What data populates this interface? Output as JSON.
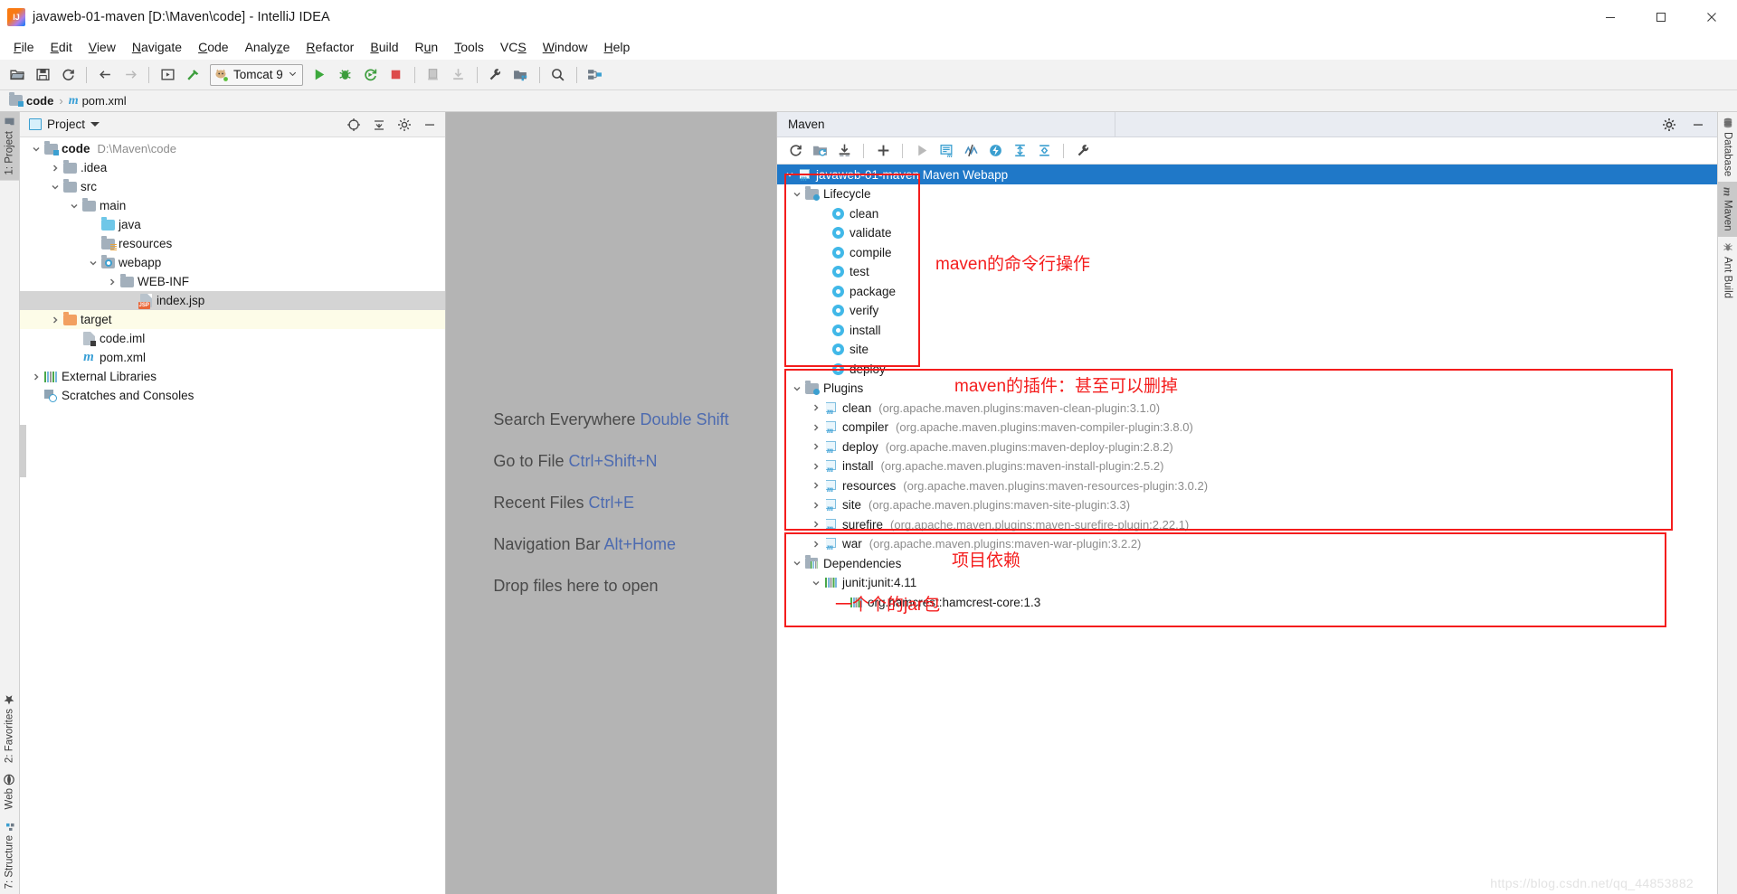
{
  "window": {
    "title": "javaweb-01-maven [D:\\Maven\\code] - IntelliJ IDEA",
    "app_icon": "intellij-idea-icon",
    "minimize": "minimize-icon",
    "maximize": "maximize-icon",
    "close": "close-icon"
  },
  "menubar": {
    "items": [
      {
        "label": "File",
        "mnemonic": "F"
      },
      {
        "label": "Edit",
        "mnemonic": "E"
      },
      {
        "label": "View",
        "mnemonic": "V"
      },
      {
        "label": "Navigate",
        "mnemonic": "N"
      },
      {
        "label": "Code",
        "mnemonic": "C"
      },
      {
        "label": "Analyze",
        "mnemonic": "z"
      },
      {
        "label": "Refactor",
        "mnemonic": "R"
      },
      {
        "label": "Build",
        "mnemonic": "B"
      },
      {
        "label": "Run",
        "mnemonic": "u"
      },
      {
        "label": "Tools",
        "mnemonic": "T"
      },
      {
        "label": "VCS",
        "mnemonic": "S"
      },
      {
        "label": "Window",
        "mnemonic": "W"
      },
      {
        "label": "Help",
        "mnemonic": "H"
      }
    ]
  },
  "toolbar": {
    "open_icon": "open-folder-icon",
    "save_icon": "save-all-icon",
    "sync_icon": "synchronize-icon",
    "back_icon": "back-arrow-icon",
    "forward_icon": "forward-arrow-icon",
    "compile_icon": "compile-icon",
    "build_icon": "build-hammer-icon",
    "run_config": {
      "label": "Tomcat 9",
      "icon": "tomcat-cat-icon",
      "dropdown": "chevron-down-icon"
    },
    "run_icon": "run-green-play-icon",
    "debug_icon": "debug-bug-icon",
    "run_coverage_icon": "run-with-coverage-icon",
    "stop_icon": "stop-red-square-icon",
    "update_app_icon": "update-application-icon",
    "deploy_icon": "deploy-icon",
    "settings_icon": "wrench-settings-icon",
    "project_structure_icon": "project-structure-icon",
    "search_icon": "search-icon",
    "vcs_icon": "vcs-operations-icon"
  },
  "breadcrumb": {
    "root": "code",
    "separator": "›",
    "file_icon": "maven-m-icon",
    "file": "pom.xml"
  },
  "left_strip": {
    "top": [
      {
        "label": "1: Project",
        "icon": "project-folder-icon",
        "active": true
      }
    ],
    "bottom": [
      {
        "label": "2: Favorites",
        "icon": "star-icon",
        "active": false
      },
      {
        "label": "Web",
        "icon": "web-globe-icon",
        "active": false
      },
      {
        "label": "7: Structure",
        "icon": "structure-icon",
        "active": false
      }
    ]
  },
  "right_strip": [
    {
      "label": "Database",
      "icon": "database-icon",
      "active": false
    },
    {
      "label": "Maven",
      "icon": "maven-m-icon",
      "active": true
    },
    {
      "label": "Ant Build",
      "icon": "ant-icon",
      "active": false
    }
  ],
  "project_panel": {
    "title": "Project",
    "dropdown_icon": "chevron-down-icon",
    "locate_icon": "scroll-from-source-icon",
    "collapse_icon": "collapse-all-icon",
    "settings_icon": "gear-icon",
    "hide_icon": "hide-icon",
    "tree": [
      {
        "label": "code",
        "sub": "D:\\Maven\\code",
        "indent": 0,
        "arrow": "down",
        "icon": "module-folder-icon",
        "bold": true,
        "state": "normal"
      },
      {
        "label": ".idea",
        "sub": "",
        "indent": 1,
        "arrow": "right",
        "icon": "folder-icon",
        "bold": false,
        "state": "normal"
      },
      {
        "label": "src",
        "sub": "",
        "indent": 1,
        "arrow": "down",
        "icon": "folder-icon",
        "bold": false,
        "state": "normal"
      },
      {
        "label": "main",
        "sub": "",
        "indent": 2,
        "arrow": "down",
        "icon": "folder-icon",
        "bold": false,
        "state": "normal"
      },
      {
        "label": "java",
        "sub": "",
        "indent": 3,
        "arrow": "none",
        "icon": "source-folder-icon",
        "bold": false,
        "state": "normal"
      },
      {
        "label": "resources",
        "sub": "",
        "indent": 3,
        "arrow": "none",
        "icon": "resources-folder-icon",
        "bold": false,
        "state": "normal"
      },
      {
        "label": "webapp",
        "sub": "",
        "indent": 3,
        "arrow": "down",
        "icon": "web-folder-icon",
        "bold": false,
        "state": "normal"
      },
      {
        "label": "WEB-INF",
        "sub": "",
        "indent": 4,
        "arrow": "right",
        "icon": "folder-icon",
        "bold": false,
        "state": "normal"
      },
      {
        "label": "index.jsp",
        "sub": "",
        "indent": 4,
        "arrow": "none",
        "icon": "jsp-file-icon",
        "bold": false,
        "state": "selected"
      },
      {
        "label": "target",
        "sub": "",
        "indent": 1,
        "arrow": "right",
        "icon": "excluded-folder-icon",
        "bold": false,
        "state": "highlighted"
      },
      {
        "label": "code.iml",
        "sub": "",
        "indent": 2,
        "arrow": "none",
        "icon": "iml-file-icon",
        "bold": false,
        "state": "normal"
      },
      {
        "label": "pom.xml",
        "sub": "",
        "indent": 2,
        "arrow": "none",
        "icon": "maven-m-icon",
        "bold": false,
        "state": "normal"
      },
      {
        "label": "External Libraries",
        "sub": "",
        "indent": 0,
        "arrow": "right",
        "icon": "library-icon",
        "bold": false,
        "state": "normal"
      },
      {
        "label": "Scratches and Consoles",
        "sub": "",
        "indent": 0,
        "arrow": "none",
        "icon": "scratches-icon",
        "bold": false,
        "state": "normal"
      }
    ]
  },
  "editor": {
    "hints": [
      {
        "action": "Search Everywhere",
        "key": "Double Shift"
      },
      {
        "action": "Go to File",
        "key": "Ctrl+Shift+N"
      },
      {
        "action": "Recent Files",
        "key": "Ctrl+E"
      },
      {
        "action": "Navigation Bar",
        "key": "Alt+Home"
      },
      {
        "action": "Drop files here to open",
        "key": ""
      }
    ]
  },
  "maven_panel": {
    "tab_title": "Maven",
    "settings_icon": "gear-icon",
    "hide_icon": "hide-icon",
    "toolbar": [
      {
        "name": "reimport-icon"
      },
      {
        "name": "generate-sources-icon"
      },
      {
        "name": "download-sources-icon"
      },
      {
        "name": "add-maven-project-icon"
      },
      {
        "name": "run-goal-icon"
      },
      {
        "name": "execute-maven-goal-icon"
      },
      {
        "name": "toggle-skip-tests-icon"
      },
      {
        "name": "toggle-offline-mode-icon"
      },
      {
        "name": "expand-all-icon"
      },
      {
        "name": "collapse-all-icon"
      },
      {
        "name": "maven-settings-icon"
      }
    ],
    "root": {
      "label": "javaweb-01-maven Maven Webapp",
      "icon": "maven-project-icon",
      "arrow": "down"
    },
    "lifecycle": {
      "label": "Lifecycle",
      "icon": "lifecycle-folder-icon",
      "arrow": "down",
      "goals": [
        "clean",
        "validate",
        "compile",
        "test",
        "package",
        "verify",
        "install",
        "site",
        "deploy"
      ]
    },
    "plugins": {
      "label": "Plugins",
      "icon": "plugins-folder-icon",
      "arrow": "down",
      "items": [
        {
          "name": "clean",
          "coords": "(org.apache.maven.plugins:maven-clean-plugin:3.1.0)"
        },
        {
          "name": "compiler",
          "coords": "(org.apache.maven.plugins:maven-compiler-plugin:3.8.0)"
        },
        {
          "name": "deploy",
          "coords": "(org.apache.maven.plugins:maven-deploy-plugin:2.8.2)"
        },
        {
          "name": "install",
          "coords": "(org.apache.maven.plugins:maven-install-plugin:2.5.2)"
        },
        {
          "name": "resources",
          "coords": "(org.apache.maven.plugins:maven-resources-plugin:3.0.2)"
        },
        {
          "name": "site",
          "coords": "(org.apache.maven.plugins:maven-site-plugin:3.3)"
        },
        {
          "name": "surefire",
          "coords": "(org.apache.maven.plugins:maven-surefire-plugin:2.22.1)"
        },
        {
          "name": "war",
          "coords": "(org.apache.maven.plugins:maven-war-plugin:3.2.2)"
        }
      ]
    },
    "dependencies": {
      "label": "Dependencies",
      "icon": "dependencies-folder-icon",
      "arrow": "down",
      "items": [
        {
          "label": "junit:junit:4.11",
          "indent": 1,
          "arrow": "down",
          "icon": "jar-icon"
        },
        {
          "label": "org.hamcrest:hamcrest-core:1.3",
          "indent": 2,
          "arrow": "none",
          "icon": "jar-icon"
        }
      ]
    }
  },
  "annotations": {
    "lifecycle_note": "maven的命令行操作",
    "plugins_note": "maven的插件：甚至可以删掉",
    "dependencies_note": "项目依赖",
    "jar_note": "一个个的jar包",
    "color": "#f41d1d"
  },
  "watermark": "https://blog.csdn.net/qq_44853882"
}
